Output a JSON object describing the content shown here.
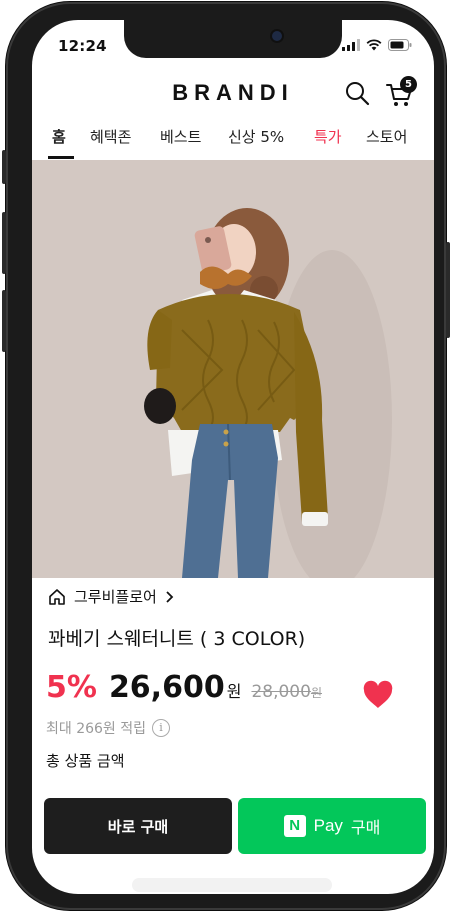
{
  "status_bar": {
    "time": "12:24"
  },
  "header": {
    "brand": "BRANDI",
    "cart_count": "5"
  },
  "tabs": [
    {
      "label": "홈",
      "active": true
    },
    {
      "label": "혜택존",
      "active": false
    },
    {
      "label": "베스트",
      "active": false
    },
    {
      "label": "신상 5%",
      "active": false
    },
    {
      "label": "특가",
      "active": false,
      "color": "#f0324f"
    },
    {
      "label": "스토어",
      "active": false
    }
  ],
  "product": {
    "store_name": "그루비플로어",
    "title": "꽈베기 스웨터니트 ( 3 COLOR)",
    "discount": "5%",
    "price": "26,600",
    "price_unit": "원",
    "original_price": "28,000",
    "original_unit": "원",
    "points_text": "최대 266원 적립",
    "total_label": "총 상품 금액",
    "liked": true
  },
  "actions": {
    "buy_now": "바로 구매",
    "npay_logo": "N",
    "npay_label": "Pay",
    "npay_suffix": "구매"
  },
  "colors": {
    "accent": "#f0324f",
    "npay": "#03c75a",
    "dark_button": "#1e1e1e"
  },
  "icons": [
    "search-icon",
    "cart-icon",
    "home-icon",
    "chevron-right-icon",
    "heart-icon",
    "info-icon",
    "signal-icon",
    "wifi-icon",
    "battery-icon"
  ]
}
